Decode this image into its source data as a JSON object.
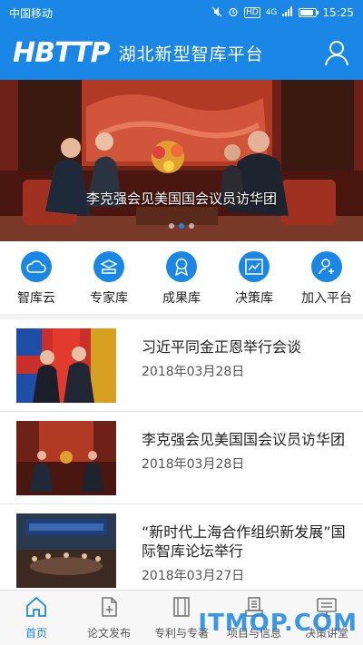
{
  "status_bar": {
    "carrier": "中国移动",
    "network_badge": "HD",
    "signal": "4G",
    "time": "15:25",
    "battery_level": 0.85
  },
  "header": {
    "logo": "HBTTP",
    "title": "湖北新型智库平台",
    "user_icon": "user-icon"
  },
  "banner": {
    "caption": "李克强会见美国国会议员访华团",
    "dots": 3,
    "active_dot": 1
  },
  "quick_nav": [
    {
      "label": "智库云",
      "icon": "cloud-icon"
    },
    {
      "label": "专家库",
      "icon": "expert-icon"
    },
    {
      "label": "成果库",
      "icon": "award-icon"
    },
    {
      "label": "决策库",
      "icon": "chart-icon"
    },
    {
      "label": "加入平台",
      "icon": "add-user-icon"
    }
  ],
  "news": [
    {
      "title": "习近平同金正恩举行会谈",
      "date": "2018年03月28日"
    },
    {
      "title": "李克强会见美国国会议员访华团",
      "date": "2018年03月28日"
    },
    {
      "title": "“新时代上海合作组织新发展”国际智库论坛举行",
      "date": "2018年03月27日"
    }
  ],
  "tabs": [
    {
      "label": "首页",
      "icon": "home-icon",
      "active": true
    },
    {
      "label": "论文发布",
      "icon": "document-add-icon",
      "active": false
    },
    {
      "label": "专利与专著",
      "icon": "book-icon",
      "active": false
    },
    {
      "label": "项目与信息",
      "icon": "project-icon",
      "active": false
    },
    {
      "label": "决策讲堂",
      "icon": "lecture-icon",
      "active": false
    }
  ],
  "watermark": "ITMOP.COM",
  "colors": {
    "brand_blue": "#1a87e6",
    "background": "#f2f2f2"
  }
}
